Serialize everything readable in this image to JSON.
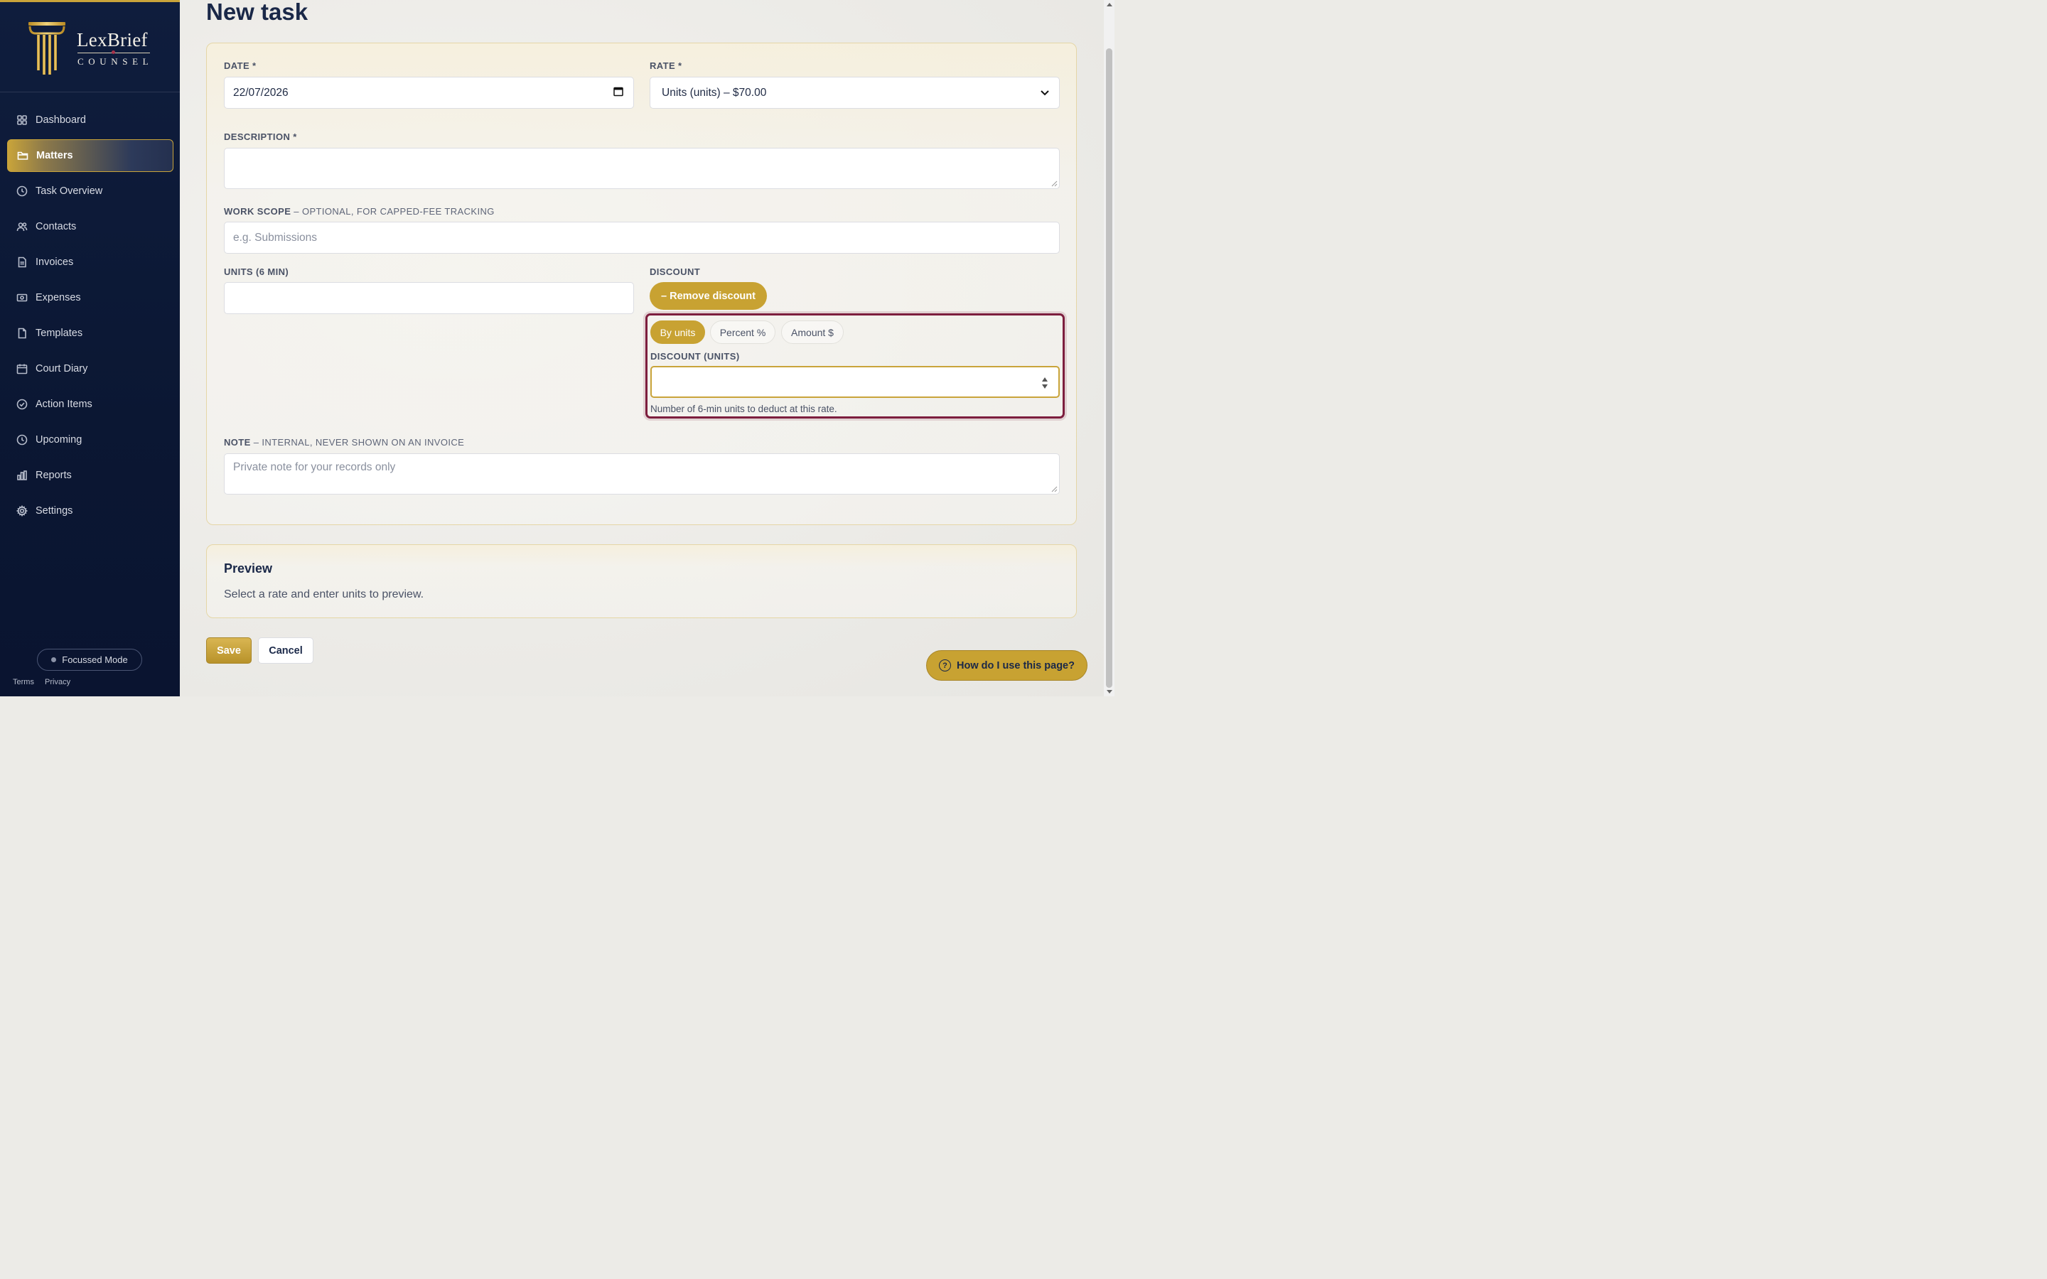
{
  "brand": {
    "name": "LexBrief",
    "sub": "COUNSEL"
  },
  "sidebar": {
    "items": [
      {
        "label": "Dashboard",
        "icon": "grid-icon"
      },
      {
        "label": "Matters",
        "icon": "folder-icon",
        "active": true
      },
      {
        "label": "Task Overview",
        "icon": "clock-icon"
      },
      {
        "label": "Contacts",
        "icon": "users-icon"
      },
      {
        "label": "Invoices",
        "icon": "document-icon"
      },
      {
        "label": "Expenses",
        "icon": "banknote-icon"
      },
      {
        "label": "Templates",
        "icon": "file-icon"
      },
      {
        "label": "Court Diary",
        "icon": "calendar-icon"
      },
      {
        "label": "Action Items",
        "icon": "check-circle-icon"
      },
      {
        "label": "Upcoming",
        "icon": "clock-icon"
      },
      {
        "label": "Reports",
        "icon": "bar-chart-icon"
      },
      {
        "label": "Settings",
        "icon": "gear-icon"
      }
    ],
    "focus_mode": "Focussed Mode",
    "terms": "Terms",
    "privacy": "Privacy"
  },
  "page": {
    "title": "New task"
  },
  "form": {
    "date_label": "DATE *",
    "date_value": "22/07/2026",
    "rate_label": "RATE *",
    "rate_value": "Units (units) – $70.00",
    "description_label": "DESCRIPTION *",
    "work_scope_label": "WORK SCOPE",
    "work_scope_optional": " – OPTIONAL, FOR CAPPED-FEE TRACKING",
    "work_scope_placeholder": "e.g. Submissions",
    "units_label": "UNITS (6 MIN)",
    "discount_label": "DISCOUNT",
    "remove_discount": "– Remove discount",
    "discount_modes": [
      "By units",
      "Percent %",
      "Amount $"
    ],
    "discount_units_label": "DISCOUNT (UNITS)",
    "discount_help": "Number of 6-min units to deduct at this rate.",
    "note_label": "NOTE",
    "note_optional": " – INTERNAL, NEVER SHOWN ON AN INVOICE",
    "note_placeholder": "Private note for your records only"
  },
  "preview": {
    "title": "Preview",
    "text": "Select a rate and enter units to preview."
  },
  "actions": {
    "save": "Save",
    "cancel": "Cancel",
    "help": "How do I use this page?"
  },
  "colors": {
    "accent": "#c8a232",
    "sidebar": "#0f1d3d",
    "focus_ring": "#7d1e3e"
  }
}
